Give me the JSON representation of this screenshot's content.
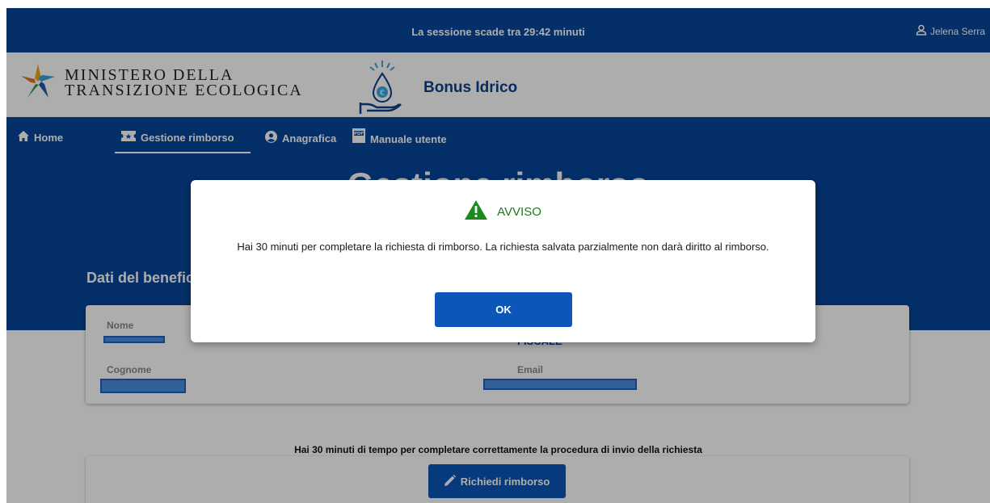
{
  "session": {
    "text": "La sessione scade tra 29:42 minuti",
    "user_name": "Jelena Serra"
  },
  "header": {
    "ministry_line1": "MINISTERO DELLA",
    "ministry_line2": "TRANSIZIONE ECOLOGICA",
    "app_title": "Bonus Idrico"
  },
  "nav": {
    "items": [
      {
        "label": "Home",
        "icon": "home-icon"
      },
      {
        "label": "Gestione rimborso",
        "icon": "ticket-icon"
      },
      {
        "label": "Anagrafica",
        "icon": "user-circle-icon"
      },
      {
        "label": "Manuale utente",
        "icon": "pdf-icon"
      }
    ],
    "active": "Gestione rimborso"
  },
  "hero": {
    "title": "Gestione rimborso",
    "section_title": "Dati del benefic"
  },
  "card": {
    "fields": [
      {
        "label": "Nome"
      },
      {
        "label": "Cognome"
      },
      {
        "label": "Email"
      }
    ],
    "partial_value": "FISCALE"
  },
  "info": {
    "text": "Hai 30 minuti di tempo per completare correttamente la procedura di invio della richiesta"
  },
  "actions": {
    "request_label": "Richiedi rimborso"
  },
  "modal": {
    "title": "AVVISO",
    "message": "Hai 30 minuti per completare la richiesta di rimborso. La richiesta salvata parzialmente non darà diritto al rimborso.",
    "ok_label": "OK"
  },
  "colors": {
    "primary": "#06469a",
    "button": "#0b56b8",
    "warning": "#1a8a1a",
    "redaction": "#4a8fe0"
  }
}
